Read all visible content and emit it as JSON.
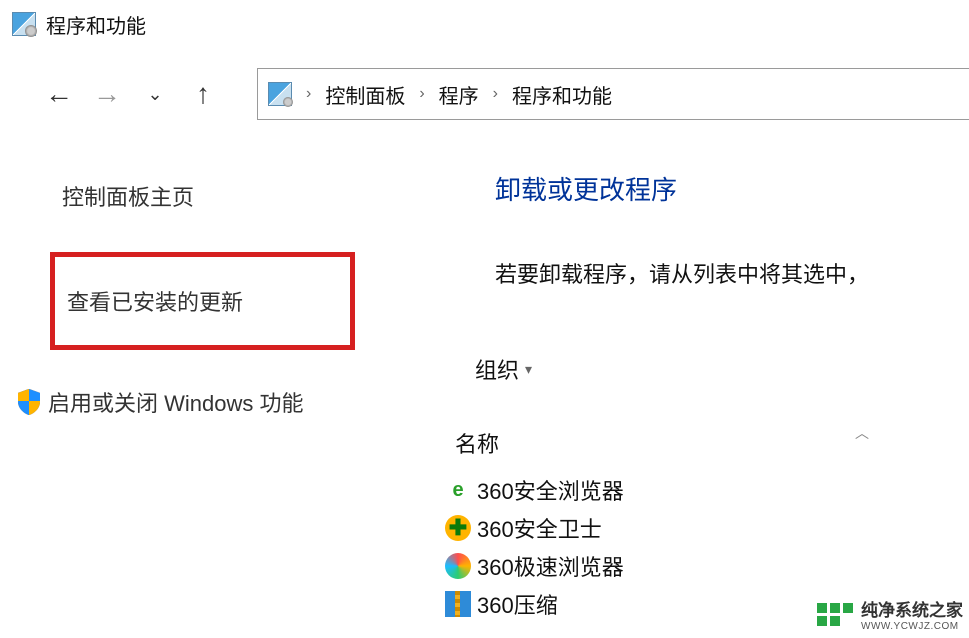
{
  "window": {
    "title": "程序和功能"
  },
  "breadcrumbs": {
    "a": "控制面板",
    "b": "程序",
    "c": "程序和功能"
  },
  "sidebar": {
    "home": "控制面板主页",
    "updates": "查看已安装的更新",
    "features": "启用或关闭 Windows 功能"
  },
  "main": {
    "title": "卸载或更改程序",
    "desc": "若要卸载程序，请从列表中将其选中，",
    "organize": "组织",
    "column_name": "名称"
  },
  "programs": {
    "p0": "360安全浏览器",
    "p1": "360安全卫士",
    "p2": "360极速浏览器",
    "p3": "360压缩"
  },
  "watermark": {
    "cn": "纯净系统之家",
    "url": "WWW.YCWJZ.COM"
  }
}
